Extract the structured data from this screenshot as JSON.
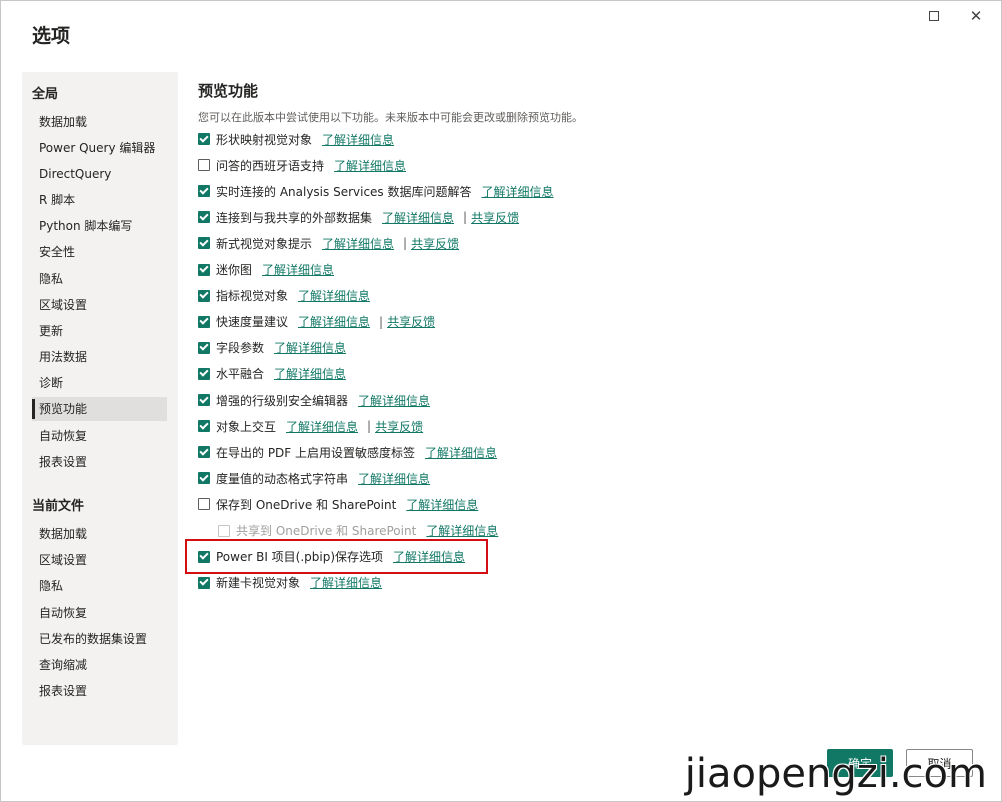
{
  "dialog": {
    "title": "选项"
  },
  "window_controls": {
    "maximize_icon": "maximize-icon",
    "close_glyph": "✕"
  },
  "sidebar": {
    "global_title": "全局",
    "global_items": [
      {
        "label": "数据加载"
      },
      {
        "label": "Power Query 编辑器"
      },
      {
        "label": "DirectQuery"
      },
      {
        "label": "R 脚本"
      },
      {
        "label": "Python 脚本编写"
      },
      {
        "label": "安全性"
      },
      {
        "label": "隐私"
      },
      {
        "label": "区域设置"
      },
      {
        "label": "更新"
      },
      {
        "label": "用法数据"
      },
      {
        "label": "诊断"
      },
      {
        "label": "预览功能"
      },
      {
        "label": "自动恢复"
      },
      {
        "label": "报表设置"
      }
    ],
    "active_item": "预览功能",
    "current_file_title": "当前文件",
    "current_file_items": [
      {
        "label": "数据加载"
      },
      {
        "label": "区域设置"
      },
      {
        "label": "隐私"
      },
      {
        "label": "自动恢复"
      },
      {
        "label": "已发布的数据集设置"
      },
      {
        "label": "查询缩减"
      },
      {
        "label": "报表设置"
      }
    ]
  },
  "main": {
    "section_title": "预览功能",
    "description": "您可以在此版本中尝试使用以下功能。未来版本中可能会更改或删除预览功能。",
    "learn_more": "了解详细信息",
    "feedback": "共享反馈",
    "separator": "|",
    "options": [
      {
        "label": "形状映射视觉对象",
        "checked": true
      },
      {
        "label": "问答的西班牙语支持",
        "checked": false
      },
      {
        "label": "实时连接的 Analysis Services 数据库问题解答",
        "checked": true
      },
      {
        "label": "连接到与我共享的外部数据集",
        "checked": true,
        "feedback": true
      },
      {
        "label": "新式视觉对象提示",
        "checked": true,
        "feedback": true
      },
      {
        "label": "迷你图",
        "checked": true
      },
      {
        "label": "指标视觉对象",
        "checked": true
      },
      {
        "label": "快速度量建议",
        "checked": true,
        "feedback": true
      },
      {
        "label": "字段参数",
        "checked": true
      },
      {
        "label": "水平融合",
        "checked": true
      },
      {
        "label": "增强的行级别安全编辑器",
        "checked": true
      },
      {
        "label": "对象上交互",
        "checked": true,
        "feedback": true
      },
      {
        "label": "在导出的 PDF 上启用设置敏感度标签",
        "checked": true
      },
      {
        "label": "度量值的动态格式字符串",
        "checked": true
      },
      {
        "label": "保存到 OneDrive 和 SharePoint",
        "checked": false
      },
      {
        "label": "共享到 OneDrive 和 SharePoint",
        "checked": false,
        "disabled": true,
        "indent": true
      },
      {
        "label": "Power BI 项目(.pbip)保存选项",
        "checked": true,
        "highlighted": true
      },
      {
        "label": "新建卡视觉对象",
        "checked": true
      }
    ]
  },
  "footer": {
    "ok_label": "确定",
    "cancel_label": "取消"
  },
  "watermark": "jiaopengzi.com",
  "colors": {
    "accent": "#117865",
    "highlight": "#d40f14"
  }
}
